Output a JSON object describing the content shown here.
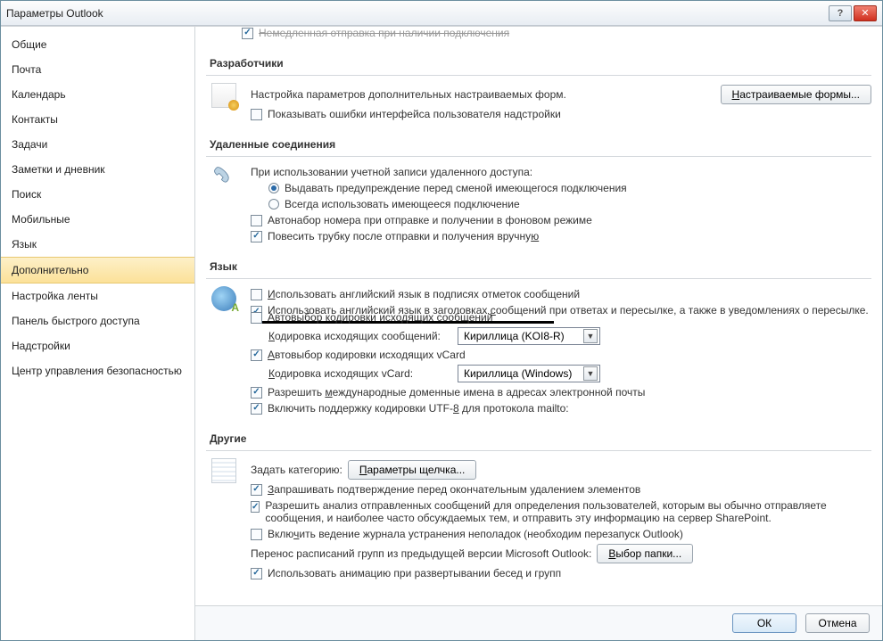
{
  "title": "Параметры Outlook",
  "sidebar": {
    "items": [
      {
        "label": "Общие"
      },
      {
        "label": "Почта"
      },
      {
        "label": "Календарь"
      },
      {
        "label": "Контакты"
      },
      {
        "label": "Задачи"
      },
      {
        "label": "Заметки и дневник"
      },
      {
        "label": "Поиск"
      },
      {
        "label": "Мобильные"
      },
      {
        "label": "Язык"
      },
      {
        "label": "Дополнительно"
      },
      {
        "label": "Настройка ленты"
      },
      {
        "label": "Панель быстрого доступа"
      },
      {
        "label": "Надстройки"
      },
      {
        "label": "Центр управления безопасностью"
      }
    ],
    "selected_index": 9
  },
  "truncated_top": "Немедленная отправка при наличии подключения",
  "sections": {
    "dev": {
      "title": "Разработчики",
      "line1": "Настройка параметров дополнительных настраиваемых форм.",
      "custom_forms_btn": "Настраиваемые формы...",
      "show_errors": "Показывать ошибки интерфейса пользователя надстройки"
    },
    "dialup": {
      "title": "Удаленные соединения",
      "intro": "При использовании учетной записи удаленного доступа:",
      "radio_warn": "Выдавать предупреждение перед сменой имеющегося подключения",
      "radio_always": "Всегда использовать имеющееся подключение",
      "auto_dial": "Автонабор номера при отправке и получении в фоновом режиме",
      "hangup": "Повесить трубку после отправки и получения вручную"
    },
    "lang": {
      "title": "Язык",
      "eng_flags": "Использовать английский язык в подписях отметок сообщений",
      "eng_headers": "Использовать английский язык в заголовках сообщений при ответах и пересылке, а также в уведомлениях о пересылке.",
      "auto_enc_out": "Автовыбор кодировки исходящих сообщений",
      "enc_out_label": "Кодировка исходящих сообщений:",
      "enc_out_value": "Кириллица (KOI8-R)",
      "auto_enc_vcard": "Автовыбор кодировки исходящих vCard",
      "enc_vcard_label": "Кодировка исходящих vCard:",
      "enc_vcard_value": "Кириллица (Windows)",
      "idn": "Разрешить международные доменные имена в адресах электронной почты",
      "utf8_mailto": "Включить поддержку кодировки UTF-8 для протокола mailto:"
    },
    "other": {
      "title": "Другие",
      "set_category": "Задать категорию:",
      "click_params_btn": "Параметры щелчка...",
      "confirm_delete": "Запрашивать подтверждение перед окончательным удалением элементов",
      "analyze_sent": "Разрешить анализ отправленных сообщений для определения пользователей, которым вы обычно отправляете сообщения, и наиболее часто обсуждаемых тем, и отправить эту информацию на сервер SharePoint.",
      "troubleshoot_log": "Включить ведение журнала устранения неполадок (необходим перезапуск Outlook)",
      "migrate_label": "Перенос расписаний групп из предыдущей версии Microsoft Outlook:",
      "select_folder_btn": "Выбор папки...",
      "use_animation": "Использовать анимацию при развертывании бесед и групп"
    }
  },
  "footer": {
    "ok": "ОК",
    "cancel": "Отмена"
  }
}
